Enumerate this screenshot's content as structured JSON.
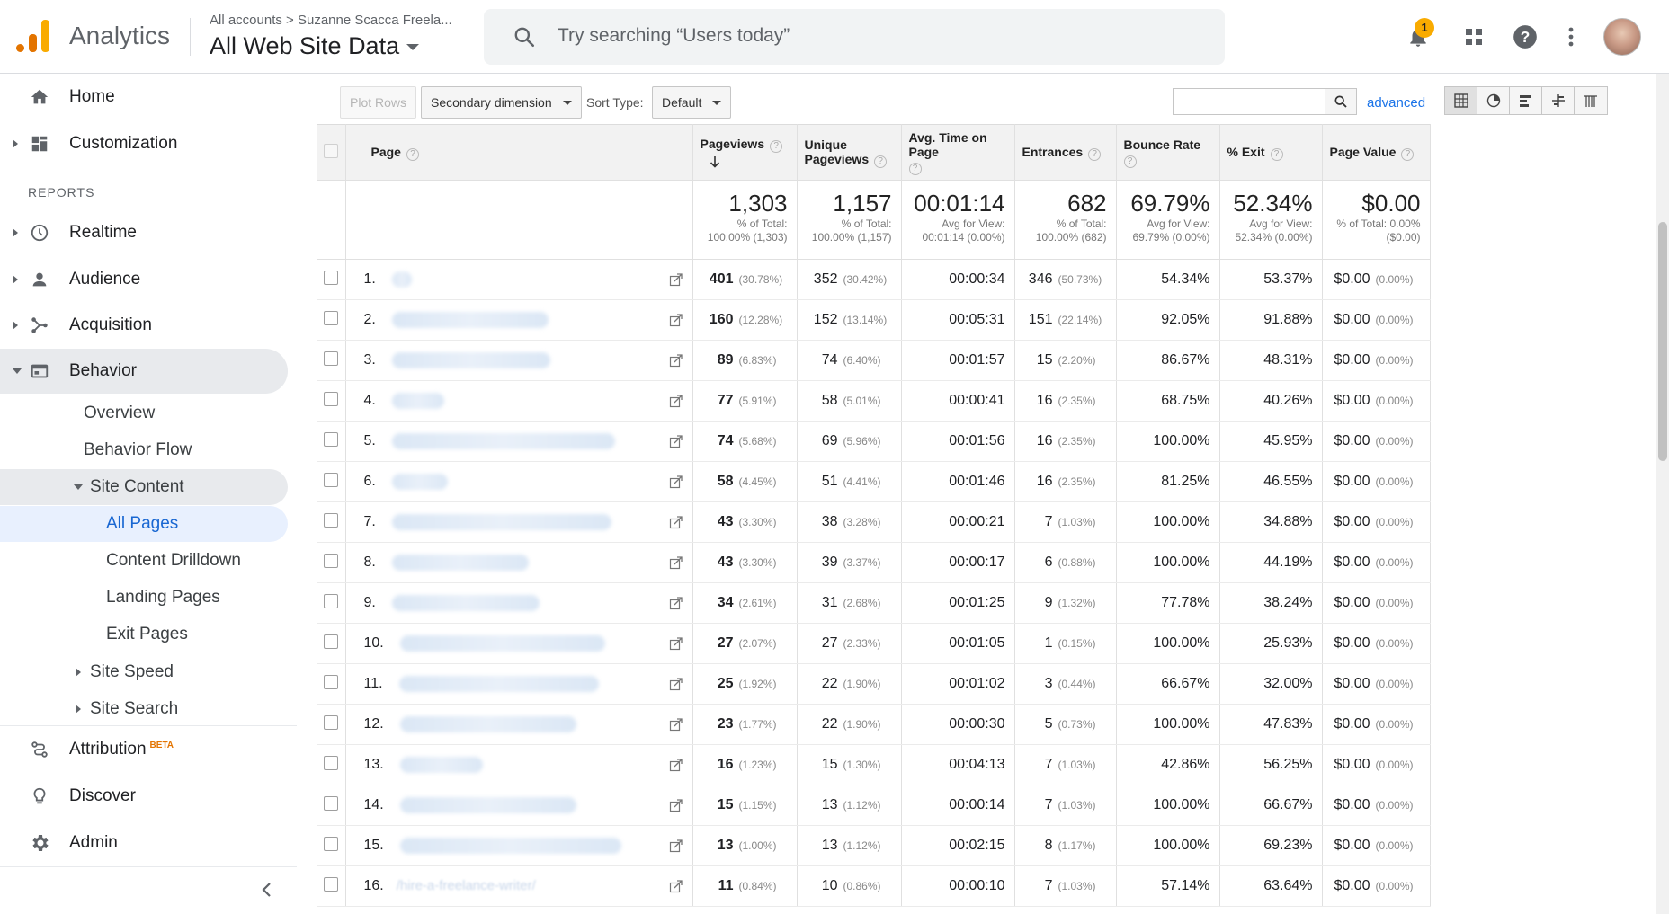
{
  "header": {
    "app_name": "Analytics",
    "breadcrumb": "All accounts  >  Suzanne Scacca Freela...",
    "property": "All Web Site Data",
    "search_placeholder": "Try searching “Users today”",
    "notification_count": "1"
  },
  "sidebar": {
    "home": "Home",
    "customization": "Customization",
    "reports_header": "REPORTS",
    "realtime": "Realtime",
    "audience": "Audience",
    "acquisition": "Acquisition",
    "behavior": "Behavior",
    "overview": "Overview",
    "behavior_flow": "Behavior Flow",
    "site_content": "Site Content",
    "all_pages": "All Pages",
    "content_drilldown": "Content Drilldown",
    "landing_pages": "Landing Pages",
    "exit_pages": "Exit Pages",
    "site_speed": "Site Speed",
    "site_search": "Site Search",
    "attribution": "Attribution",
    "attribution_badge": "BETA",
    "discover": "Discover",
    "admin": "Admin"
  },
  "toolbar": {
    "plot_rows": "Plot Rows",
    "secondary_dimension": "Secondary dimension",
    "sort_type_label": "Sort Type:",
    "sort_type_value": "Default",
    "advanced": "advanced"
  },
  "table": {
    "headers": {
      "page": "Page",
      "pageviews": "Pageviews",
      "unique_pageviews": "Unique Pageviews",
      "avg_time": "Avg. Time on Page",
      "entrances": "Entrances",
      "bounce_rate": "Bounce Rate",
      "exit": "% Exit",
      "page_value": "Page Value"
    },
    "totals": {
      "pageviews": {
        "value": "1,303",
        "l1": "% of Total:",
        "l2": "100.00% (1,303)"
      },
      "unique_pageviews": {
        "value": "1,157",
        "l1": "% of Total:",
        "l2": "100.00% (1,157)"
      },
      "avg_time": {
        "value": "00:01:14",
        "l1": "Avg for View:",
        "l2": "00:01:14 (0.00%)"
      },
      "entrances": {
        "value": "682",
        "l1": "% of Total:",
        "l2": "100.00% (682)"
      },
      "bounce_rate": {
        "value": "69.79%",
        "l1": "Avg for View:",
        "l2": "69.79% (0.00%)"
      },
      "exit": {
        "value": "52.34%",
        "l1": "Avg for View:",
        "l2": "52.34% (0.00%)"
      },
      "page_value": {
        "value": "$0.00",
        "l1": "% of Total: 0.00%",
        "l2": "($0.00)"
      }
    },
    "rows": [
      {
        "idx": "1.",
        "page": "",
        "pv": "401",
        "pv_pct": "(30.78%)",
        "upv": "352",
        "upv_pct": "(30.42%)",
        "time": "00:00:34",
        "ent": "346",
        "ent_pct": "(50.73%)",
        "bounce": "54.34%",
        "exit": "53.37%",
        "val": "$0.00",
        "val_pct": "(0.00%)"
      },
      {
        "idx": "2.",
        "page": "",
        "pv": "160",
        "pv_pct": "(12.28%)",
        "upv": "152",
        "upv_pct": "(13.14%)",
        "time": "00:05:31",
        "ent": "151",
        "ent_pct": "(22.14%)",
        "bounce": "92.05%",
        "exit": "91.88%",
        "val": "$0.00",
        "val_pct": "(0.00%)"
      },
      {
        "idx": "3.",
        "page": "",
        "pv": "89",
        "pv_pct": "(6.83%)",
        "upv": "74",
        "upv_pct": "(6.40%)",
        "time": "00:01:57",
        "ent": "15",
        "ent_pct": "(2.20%)",
        "bounce": "86.67%",
        "exit": "48.31%",
        "val": "$0.00",
        "val_pct": "(0.00%)"
      },
      {
        "idx": "4.",
        "page": "",
        "pv": "77",
        "pv_pct": "(5.91%)",
        "upv": "58",
        "upv_pct": "(5.01%)",
        "time": "00:00:41",
        "ent": "16",
        "ent_pct": "(2.35%)",
        "bounce": "68.75%",
        "exit": "40.26%",
        "val": "$0.00",
        "val_pct": "(0.00%)"
      },
      {
        "idx": "5.",
        "page": "",
        "pv": "74",
        "pv_pct": "(5.68%)",
        "upv": "69",
        "upv_pct": "(5.96%)",
        "time": "00:01:56",
        "ent": "16",
        "ent_pct": "(2.35%)",
        "bounce": "100.00%",
        "exit": "45.95%",
        "val": "$0.00",
        "val_pct": "(0.00%)"
      },
      {
        "idx": "6.",
        "page": "",
        "pv": "58",
        "pv_pct": "(4.45%)",
        "upv": "51",
        "upv_pct": "(4.41%)",
        "time": "00:01:46",
        "ent": "16",
        "ent_pct": "(2.35%)",
        "bounce": "81.25%",
        "exit": "46.55%",
        "val": "$0.00",
        "val_pct": "(0.00%)"
      },
      {
        "idx": "7.",
        "page": "",
        "pv": "43",
        "pv_pct": "(3.30%)",
        "upv": "38",
        "upv_pct": "(3.28%)",
        "time": "00:00:21",
        "ent": "7",
        "ent_pct": "(1.03%)",
        "bounce": "100.00%",
        "exit": "34.88%",
        "val": "$0.00",
        "val_pct": "(0.00%)"
      },
      {
        "idx": "8.",
        "page": "",
        "pv": "43",
        "pv_pct": "(3.30%)",
        "upv": "39",
        "upv_pct": "(3.37%)",
        "time": "00:00:17",
        "ent": "6",
        "ent_pct": "(0.88%)",
        "bounce": "100.00%",
        "exit": "44.19%",
        "val": "$0.00",
        "val_pct": "(0.00%)"
      },
      {
        "idx": "9.",
        "page": "",
        "pv": "34",
        "pv_pct": "(2.61%)",
        "upv": "31",
        "upv_pct": "(2.68%)",
        "time": "00:01:25",
        "ent": "9",
        "ent_pct": "(1.32%)",
        "bounce": "77.78%",
        "exit": "38.24%",
        "val": "$0.00",
        "val_pct": "(0.00%)"
      },
      {
        "idx": "10.",
        "page": "",
        "pv": "27",
        "pv_pct": "(2.07%)",
        "upv": "27",
        "upv_pct": "(2.33%)",
        "time": "00:01:05",
        "ent": "1",
        "ent_pct": "(0.15%)",
        "bounce": "100.00%",
        "exit": "25.93%",
        "val": "$0.00",
        "val_pct": "(0.00%)"
      },
      {
        "idx": "11.",
        "page": "",
        "pv": "25",
        "pv_pct": "(1.92%)",
        "upv": "22",
        "upv_pct": "(1.90%)",
        "time": "00:01:02",
        "ent": "3",
        "ent_pct": "(0.44%)",
        "bounce": "66.67%",
        "exit": "32.00%",
        "val": "$0.00",
        "val_pct": "(0.00%)"
      },
      {
        "idx": "12.",
        "page": "",
        "pv": "23",
        "pv_pct": "(1.77%)",
        "upv": "22",
        "upv_pct": "(1.90%)",
        "time": "00:00:30",
        "ent": "5",
        "ent_pct": "(0.73%)",
        "bounce": "100.00%",
        "exit": "47.83%",
        "val": "$0.00",
        "val_pct": "(0.00%)"
      },
      {
        "idx": "13.",
        "page": "",
        "pv": "16",
        "pv_pct": "(1.23%)",
        "upv": "15",
        "upv_pct": "(1.30%)",
        "time": "00:04:13",
        "ent": "7",
        "ent_pct": "(1.03%)",
        "bounce": "42.86%",
        "exit": "56.25%",
        "val": "$0.00",
        "val_pct": "(0.00%)"
      },
      {
        "idx": "14.",
        "page": "",
        "pv": "15",
        "pv_pct": "(1.15%)",
        "upv": "13",
        "upv_pct": "(1.12%)",
        "time": "00:00:14",
        "ent": "7",
        "ent_pct": "(1.03%)",
        "bounce": "100.00%",
        "exit": "66.67%",
        "val": "$0.00",
        "val_pct": "(0.00%)"
      },
      {
        "idx": "15.",
        "page": "",
        "pv": "13",
        "pv_pct": "(1.00%)",
        "upv": "13",
        "upv_pct": "(1.12%)",
        "time": "00:02:15",
        "ent": "8",
        "ent_pct": "(1.17%)",
        "bounce": "100.00%",
        "exit": "69.23%",
        "val": "$0.00",
        "val_pct": "(0.00%)"
      },
      {
        "idx": "16.",
        "page": "/hire-a-freelance-writer/",
        "pv": "11",
        "pv_pct": "(0.84%)",
        "upv": "10",
        "upv_pct": "(0.86%)",
        "time": "00:00:10",
        "ent": "7",
        "ent_pct": "(1.03%)",
        "bounce": "57.14%",
        "exit": "63.64%",
        "val": "$0.00",
        "val_pct": "(0.00%)"
      }
    ]
  },
  "colors": {
    "accent": "#1a73e8",
    "brand_orange": "#f9ab00",
    "brand_dark_orange": "#e37400",
    "selected_bg": "#e8f0fe"
  },
  "icons": [
    "search-icon",
    "bell-icon",
    "apps-grid-icon",
    "help-icon",
    "more-vert-icon",
    "home-icon",
    "customization-icon",
    "clock-icon",
    "person-icon",
    "acquisition-icon",
    "behavior-icon",
    "attribution-icon",
    "lightbulb-icon",
    "gear-icon",
    "chevron-left-icon",
    "external-link-icon",
    "sort-arrow-icon"
  ]
}
